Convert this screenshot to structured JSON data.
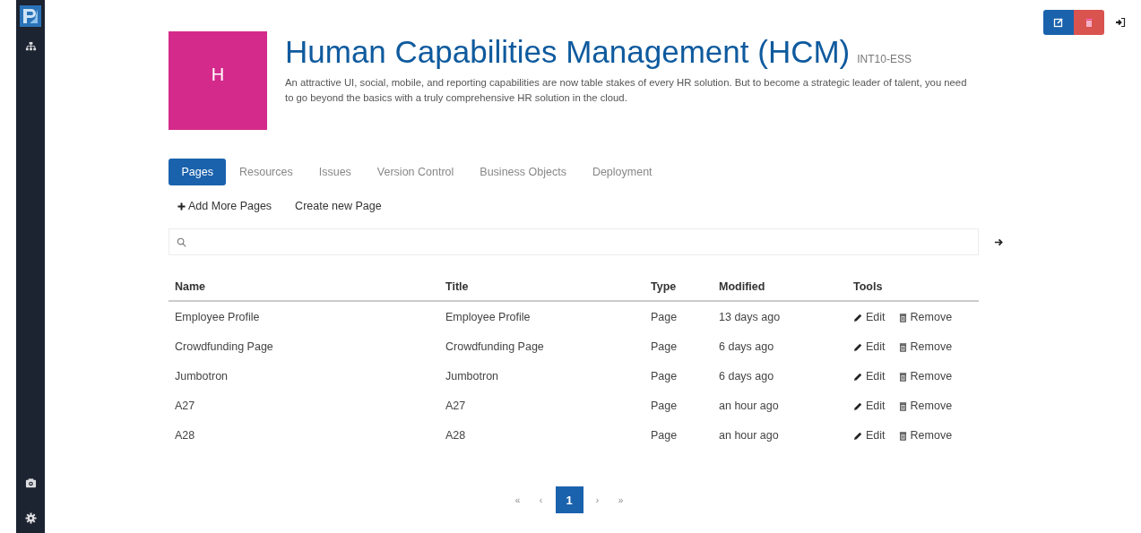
{
  "sidebar": {
    "items": [
      {
        "kind": "sitemap",
        "selected": false
      },
      {
        "kind": "camera",
        "selected": false
      },
      {
        "kind": "settings",
        "selected": false
      }
    ]
  },
  "header": {
    "tile_letter": "H",
    "title": "Human Capabilities Management (HCM)",
    "code": "INT10-ESS",
    "description": "An attractive UI, social, mobile, and reporting capabilities are now table stakes of every HR solution. But to become a strategic leader of talent, you need to go beyond the basics with a truly comprehensive HR solution in the cloud."
  },
  "tabs": [
    {
      "label": "Pages",
      "selected": true
    },
    {
      "label": "Resources",
      "selected": false
    },
    {
      "label": "Issues",
      "selected": false
    },
    {
      "label": "Version Control",
      "selected": false
    },
    {
      "label": "Business Objects",
      "selected": false
    },
    {
      "label": "Deployment",
      "selected": false
    }
  ],
  "actions": [
    {
      "label": "Add More Pages",
      "kind": "add"
    },
    {
      "label": "Create new Page",
      "kind": "plain"
    }
  ],
  "table": {
    "columns": [
      "Name",
      "Title",
      "Type",
      "Modified",
      "Tools"
    ],
    "rows": [
      {
        "cells": [
          "Employee Profile",
          "Employee Profile",
          "Page",
          "13 days ago"
        ],
        "edit": "Edit",
        "remove": "Remove"
      },
      {
        "cells": [
          "Crowdfunding Page",
          "Crowdfunding Page",
          "Page",
          "6 days ago"
        ],
        "edit": "Edit",
        "remove": "Remove"
      },
      {
        "cells": [
          "Jumbotron",
          "Jumbotron",
          "Page",
          "6 days ago"
        ],
        "edit": "Edit",
        "remove": "Remove"
      },
      {
        "cells": [
          "A27",
          "A27",
          "Page",
          "an hour ago"
        ],
        "edit": "Edit",
        "remove": "Remove"
      },
      {
        "cells": [
          "A28",
          "A28",
          "Page",
          "an hour ago"
        ],
        "edit": "Edit",
        "remove": "Remove"
      }
    ]
  },
  "pagination": [
    {
      "label": "«",
      "selected": false
    },
    {
      "label": "‹",
      "selected": false
    },
    {
      "label": "1",
      "selected": true
    },
    {
      "label": "›",
      "selected": false
    },
    {
      "label": "»",
      "selected": false
    }
  ]
}
